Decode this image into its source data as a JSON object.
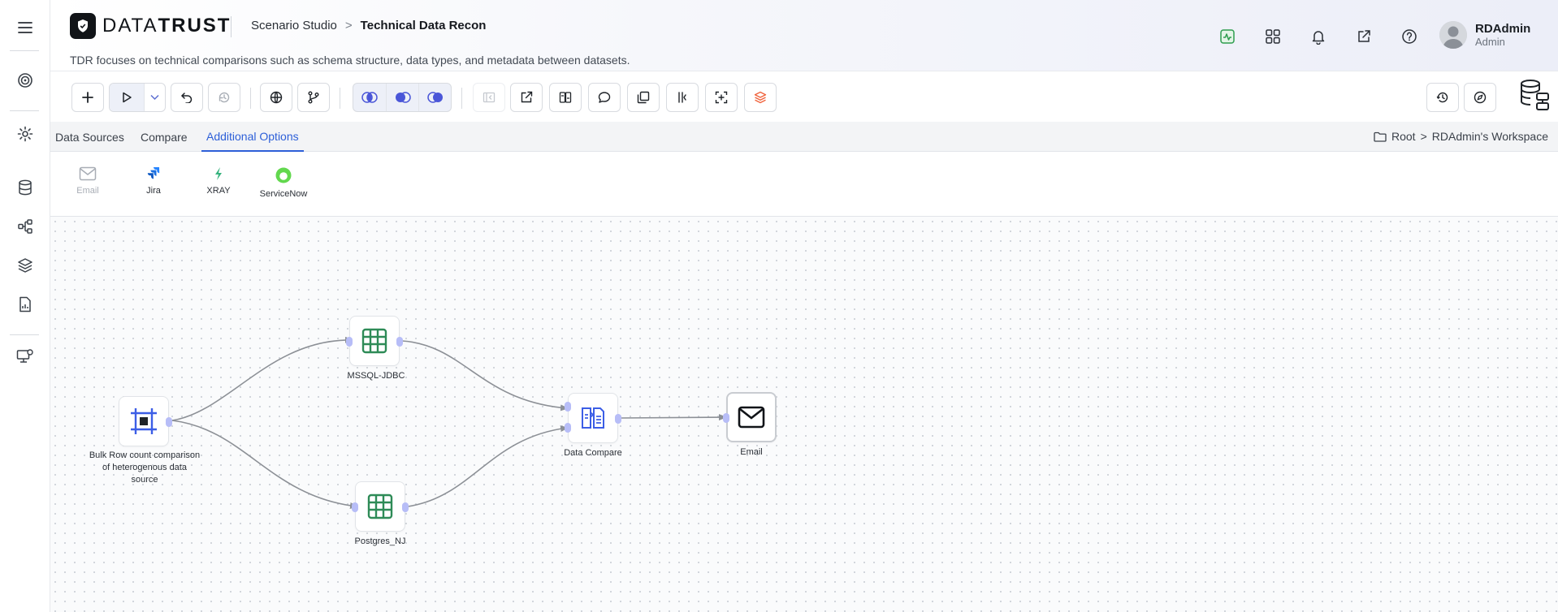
{
  "app": {
    "brand_light": "DATA",
    "brand_bold": "TRUST",
    "breadcrumb_parent": "Scenario Studio",
    "breadcrumb_separator": ">",
    "page_title": "Technical Data Recon",
    "description": "TDR focuses on technical comparisons such as schema structure, data types, and metadata between datasets."
  },
  "user": {
    "name": "RDAdmin",
    "role": "Admin"
  },
  "header_icons": [
    "activity-icon",
    "apps-grid-icon",
    "bell-icon",
    "external-link-icon",
    "help-icon"
  ],
  "tabs": [
    {
      "label": "Data Sources"
    },
    {
      "label": "Compare"
    },
    {
      "label": "Additional Options"
    }
  ],
  "active_tab": "Additional Options",
  "workspace": {
    "root": "Root",
    "separator": ">",
    "name": "RDAdmin's Workspace"
  },
  "options": [
    {
      "label": "Email",
      "enabled": false
    },
    {
      "label": "Jira",
      "enabled": true
    },
    {
      "label": "XRAY",
      "enabled": true
    },
    {
      "label": "ServiceNow",
      "enabled": true
    }
  ],
  "nodes": {
    "source": {
      "label": "Bulk Row count comparison of heterogenous data source"
    },
    "mssql": {
      "label": "MSSQL-JDBC"
    },
    "postgres": {
      "label": "Postgres_NJ"
    },
    "compare": {
      "label": "Data Compare"
    },
    "email": {
      "label": "Email"
    }
  },
  "colors": {
    "accent": "#2d5fd8",
    "port": "#b7bdf7",
    "edge": "#8c9096",
    "table_green": "#2e8b57",
    "servicenow_green": "#62d84e"
  }
}
